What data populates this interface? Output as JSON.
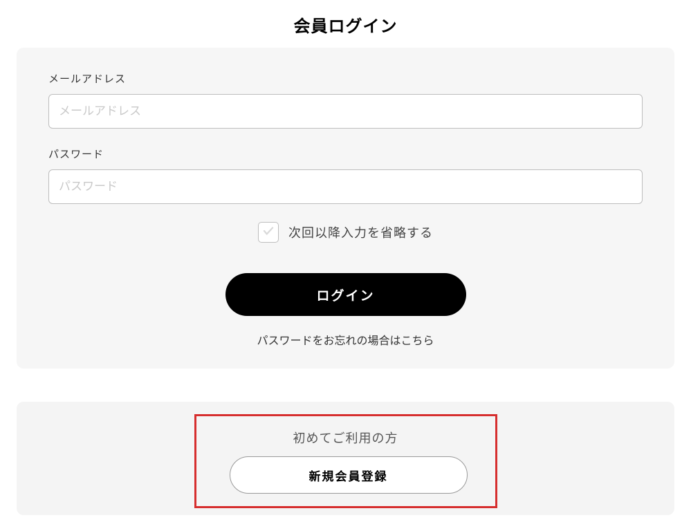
{
  "page": {
    "title": "会員ログイン"
  },
  "form": {
    "email": {
      "label": "メールアドレス",
      "placeholder": "メールアドレス",
      "value": ""
    },
    "password": {
      "label": "パスワード",
      "placeholder": "パスワード",
      "value": ""
    },
    "remember": {
      "label": "次回以降入力を省略する",
      "checked": false
    },
    "submit_label": "ログイン",
    "forgot_label": "パスワードをお忘れの場合はこちら"
  },
  "signup": {
    "heading": "初めてご利用の方",
    "button_label": "新規会員登録"
  }
}
